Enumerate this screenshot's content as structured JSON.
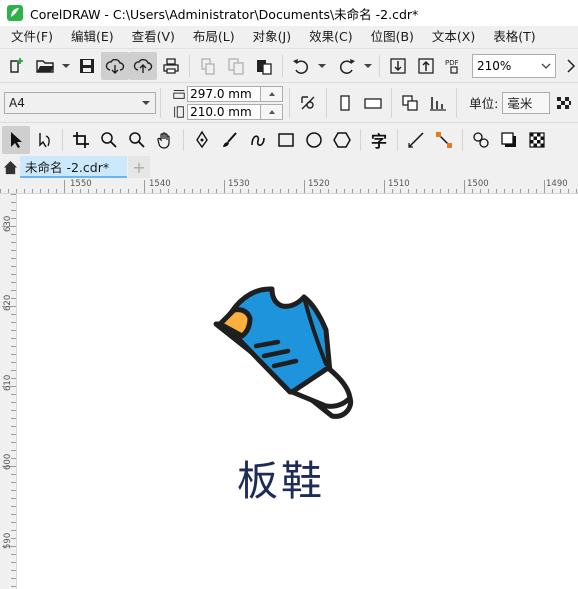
{
  "window": {
    "title": "CorelDRAW - C:\\Users\\Administrator\\Documents\\未命名 -2.cdr*"
  },
  "menu": [
    "文件(F)",
    "编辑(E)",
    "查看(V)",
    "布局(L)",
    "对象(J)",
    "效果(C)",
    "位图(B)",
    "文本(X)",
    "表格(T)"
  ],
  "toolbar": {
    "zoom_value": "210%",
    "pdf_label": "PDF"
  },
  "property_bar": {
    "page_size": "A4",
    "width": "297.0 mm",
    "height": "210.0 mm",
    "units_label": "单位:",
    "units_value": "毫米"
  },
  "toolbox": {
    "text_tool_glyph": "字"
  },
  "tabs": {
    "document_tab": "未命名 -2.cdr*",
    "new_tab": "+"
  },
  "rulers": {
    "horizontal": [
      "1550",
      "1540",
      "1530",
      "1520",
      "1510",
      "1500",
      "1490"
    ],
    "vertical": [
      "630",
      "620",
      "610",
      "600",
      "590"
    ]
  },
  "canvas": {
    "caption": "板鞋"
  },
  "colors": {
    "shoe_blue": "#1e94dc",
    "shoe_orange": "#f9b03d",
    "outline": "#1f1f1f",
    "caption_color": "#1e2b58",
    "tab_active": "#cce8fb"
  },
  "icons": {
    "app_logo": "coreldraw-logo-icon",
    "illustration": "sneaker-icon"
  }
}
